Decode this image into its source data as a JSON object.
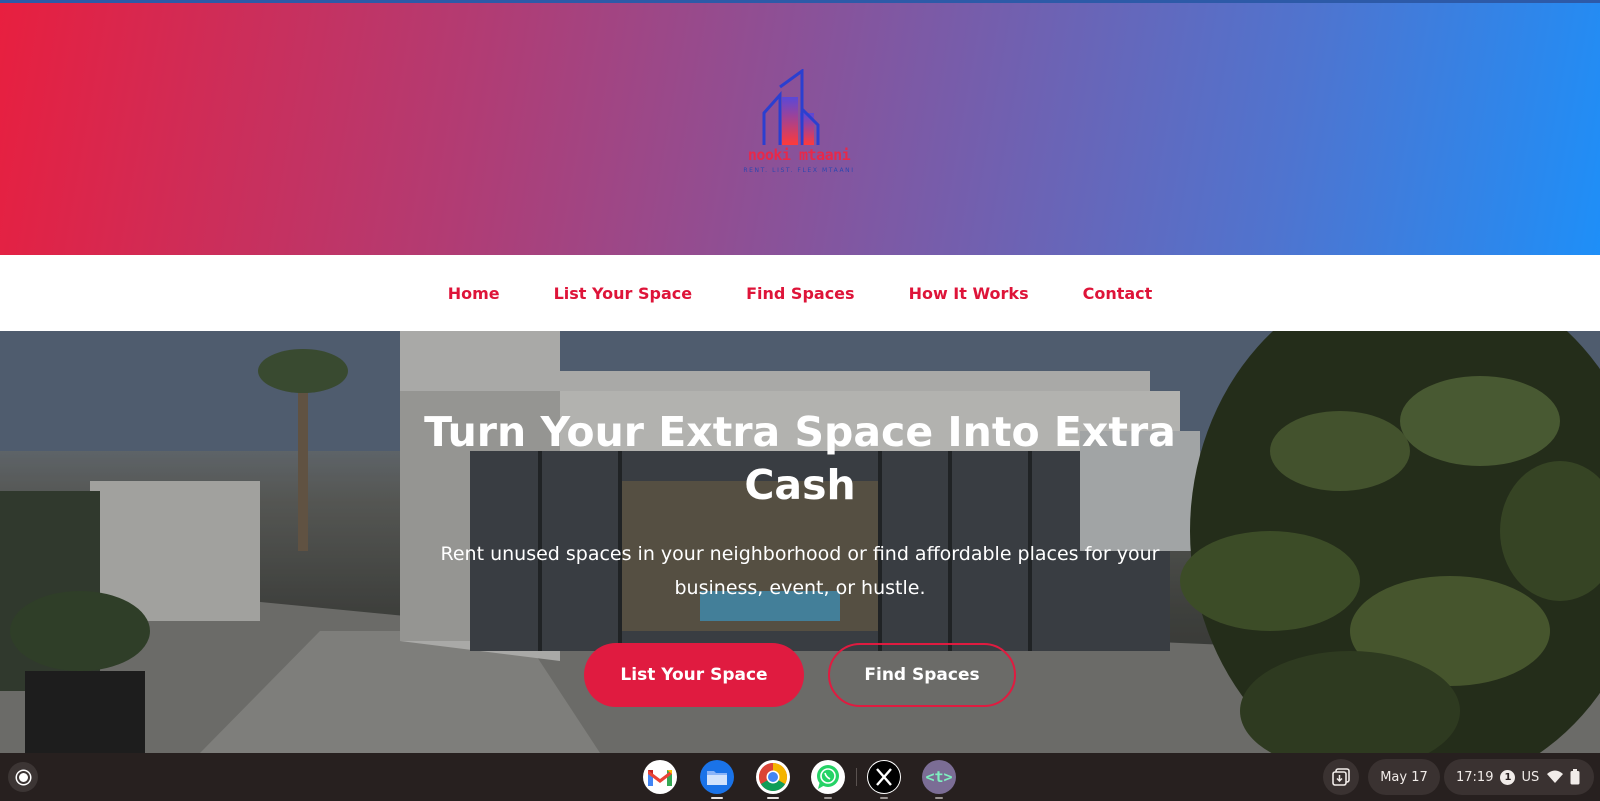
{
  "brand": {
    "name": "nooki mtaani",
    "tagline": "RENT. LIST. FLEX MTAANI"
  },
  "nav": {
    "items": [
      {
        "label": "Home"
      },
      {
        "label": "List Your Space"
      },
      {
        "label": "Find Spaces"
      },
      {
        "label": "How It Works"
      },
      {
        "label": "Contact"
      }
    ]
  },
  "hero": {
    "title": "Turn Your Extra Space Into Extra Cash",
    "subtitle": "Rent unused spaces in your neighborhood or find affordable places for your business, event, or hustle.",
    "primary_cta": "List Your Space",
    "secondary_cta": "Find Spaces"
  },
  "shelf": {
    "apps": [
      {
        "name": "gmail-icon",
        "active": false
      },
      {
        "name": "files-icon",
        "active": true
      },
      {
        "name": "chrome-icon",
        "active": true
      },
      {
        "name": "whatsapp-icon",
        "active": true
      },
      {
        "name": "x-icon",
        "active": true
      },
      {
        "name": "terminal-icon",
        "active": true
      }
    ],
    "date": "May 17",
    "time": "17:19",
    "notification_count": "1",
    "keyboard_layout": "US"
  },
  "colors": {
    "accent": "#e01b40",
    "gradient_start": "#e81f3f",
    "gradient_end": "#1e8ff8",
    "shelf_bg": "#27201f"
  }
}
